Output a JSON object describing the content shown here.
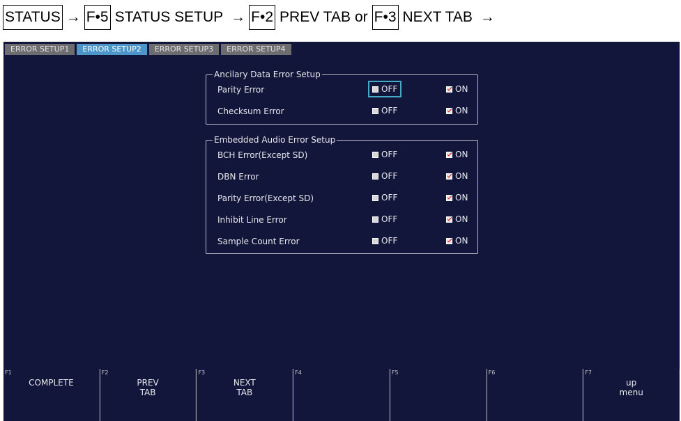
{
  "breadcrumb": {
    "status": "STATUS",
    "arrow": "→",
    "f5": "F•5",
    "status_setup": "STATUS SETUP",
    "f2": "F•2",
    "prev_tab": "PREV TAB",
    "or": "or",
    "f3": "F•3",
    "next_tab": "NEXT TAB"
  },
  "tabs": [
    "ERROR SETUP1",
    "ERROR SETUP2",
    "ERROR SETUP3",
    "ERROR SETUP4"
  ],
  "active_tab": "ERROR SETUP2",
  "ancillary": {
    "title": "Ancilary Data Error Setup",
    "rows": [
      {
        "label": "Parity Error",
        "off": "OFF",
        "on": "ON",
        "selected": "ON"
      },
      {
        "label": "Checksum Error",
        "off": "OFF",
        "on": "ON",
        "selected": "ON"
      }
    ]
  },
  "embedded": {
    "title": "Embedded Audio Error Setup",
    "rows": [
      {
        "label": "BCH Error(Except SD)",
        "off": "OFF",
        "on": "ON",
        "selected": "ON"
      },
      {
        "label": "DBN Error",
        "off": "OFF",
        "on": "ON",
        "selected": "ON"
      },
      {
        "label": "Parity Error(Except SD)",
        "off": "OFF",
        "on": "ON",
        "selected": "ON"
      },
      {
        "label": "Inhibit Line Error",
        "off": "OFF",
        "on": "ON",
        "selected": "ON"
      },
      {
        "label": "Sample Count Error",
        "off": "OFF",
        "on": "ON",
        "selected": "ON"
      }
    ]
  },
  "fkeys": [
    {
      "num": "F1",
      "label": "COMPLETE"
    },
    {
      "num": "F2",
      "label": "PREV\nTAB"
    },
    {
      "num": "F3",
      "label": "NEXT\nTAB"
    },
    {
      "num": "F4",
      "label": ""
    },
    {
      "num": "F5",
      "label": ""
    },
    {
      "num": "F6",
      "label": ""
    },
    {
      "num": "F7",
      "label": "up\nmenu"
    }
  ],
  "colors": {
    "screen_bg": "#12163a",
    "active_tab": "#4c96c9",
    "inactive_tab": "#6d6d6f",
    "check_mark": "#d21a1a",
    "focus": "#42a9c7"
  }
}
